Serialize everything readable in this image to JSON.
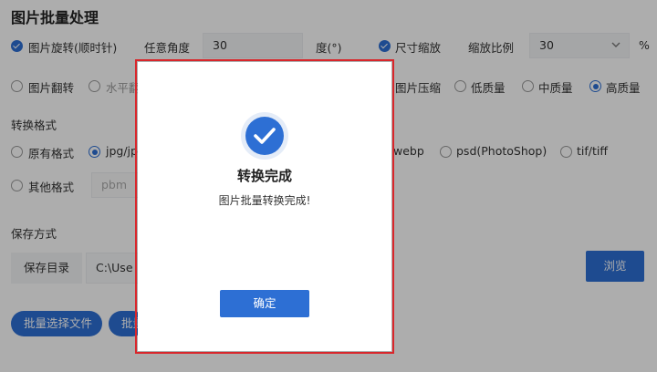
{
  "page": {
    "title": "图片批量处理"
  },
  "rotate": {
    "checkbox_label": "图片旋转(顺时针)",
    "angle_label": "任意角度",
    "angle_value": "30",
    "angle_unit": "度(°)"
  },
  "resize": {
    "checkbox_label": "尺寸缩放",
    "ratio_label": "缩放比例",
    "ratio_value": "30",
    "ratio_unit": "%"
  },
  "flip": {
    "checkbox_label": "图片翻转",
    "horizontal_label": "水平翻"
  },
  "compress": {
    "checkbox_label": "图片压缩",
    "options": [
      "低质量",
      "中质量",
      "高质量"
    ],
    "selected": "高质量"
  },
  "format": {
    "section_label": "转换格式",
    "options_visible": [
      "原有格式",
      "jpg/jp",
      "webp",
      "psd(PhotoShop)",
      "tif/tiff"
    ],
    "selected": "jpg/jp",
    "other_label": "其他格式",
    "other_placeholder": "pbm"
  },
  "save": {
    "section_label": "保存方式",
    "dir_label": "保存目录",
    "dir_value": "C:\\Use",
    "browse_label": "浏览"
  },
  "actions": {
    "batch_select_label": "批量选择文件",
    "second_label": "批量"
  },
  "modal": {
    "title": "转换完成",
    "message": "图片批量转换完成!",
    "ok_label": "确定"
  },
  "colors": {
    "primary": "#2d6fd4",
    "focus_outline": "#d9262b",
    "overlay": "rgba(0,0,0,0.32)"
  }
}
